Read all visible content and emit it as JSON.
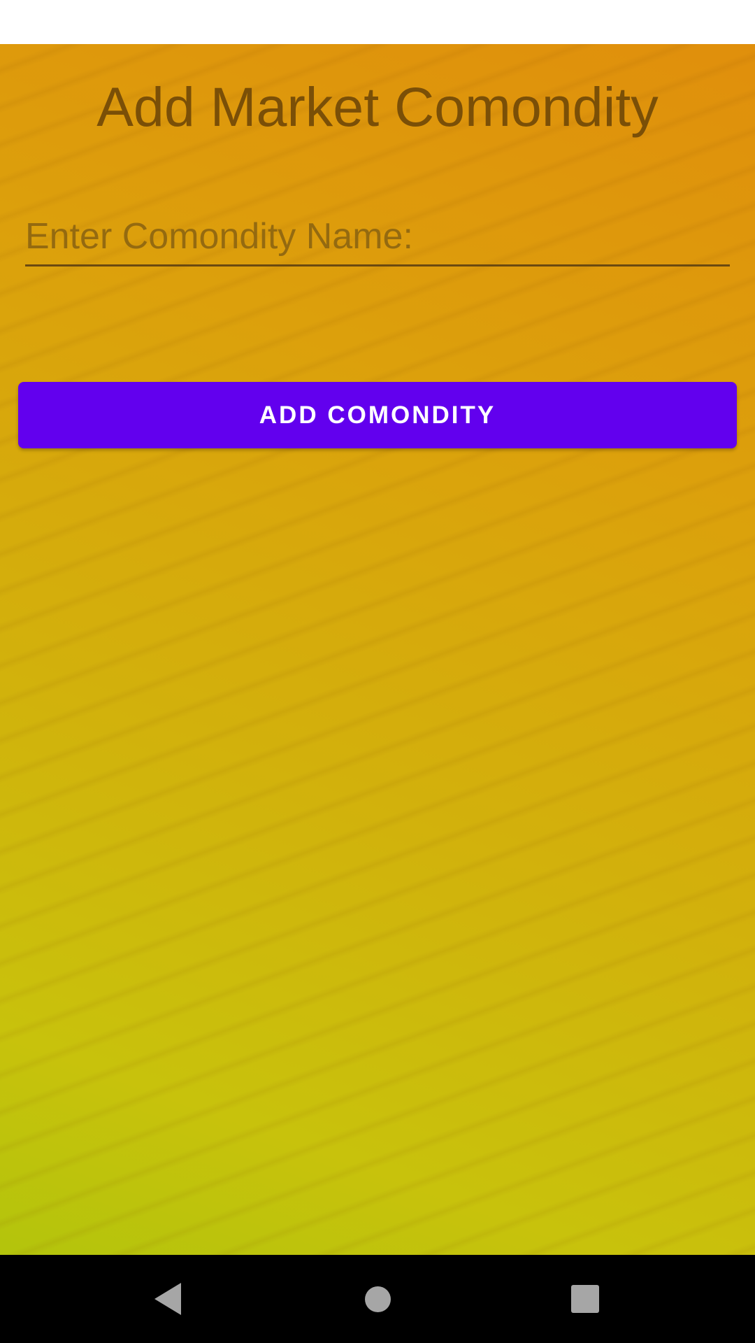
{
  "page": {
    "title": "Add Market Comondity"
  },
  "form": {
    "name_field": {
      "placeholder": "Enter Comondity Name:",
      "value": ""
    },
    "add_button_label": "ADD COMONDITY"
  },
  "navigation": {
    "back_icon": "triangle-back-icon",
    "home_icon": "circle-home-icon",
    "recents_icon": "square-recents-icon"
  },
  "colors": {
    "background_top": "#e08f0c",
    "background_bottom": "#b3c40c",
    "title_text": "#7a4f07",
    "button": "#6200ee",
    "button_text": "#ffffff",
    "nav_bar": "#000000"
  }
}
